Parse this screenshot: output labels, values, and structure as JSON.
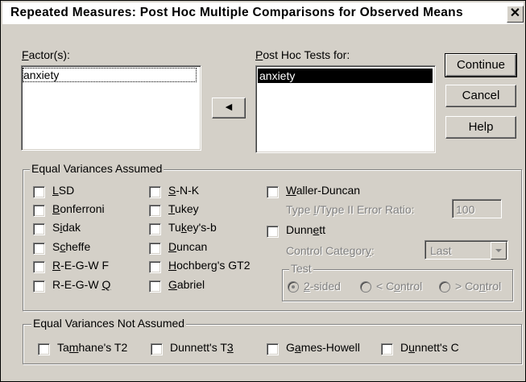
{
  "window": {
    "title": "Repeated Measures: Post Hoc Multiple Comparisons for Observed Means",
    "close": "✕"
  },
  "factors": {
    "label_u": "F",
    "label_rest": "actor(s):",
    "items": [
      "anxiety"
    ]
  },
  "posthoc": {
    "label_u": "P",
    "label_rest": "ost Hoc Tests for:",
    "items": [
      "anxiety"
    ]
  },
  "arrow": "◀",
  "buttons": {
    "continue": "Continue",
    "cancel": "Cancel",
    "help": "Help"
  },
  "equal_assumed": {
    "title": "Equal Variances Assumed",
    "col1": [
      {
        "pre": "",
        "u": "L",
        "post": "SD"
      },
      {
        "pre": "",
        "u": "B",
        "post": "onferroni"
      },
      {
        "pre": "S",
        "u": "i",
        "post": "dak"
      },
      {
        "pre": "S",
        "u": "c",
        "post": "heffe"
      },
      {
        "pre": "",
        "u": "R",
        "post": "-E-G-W F"
      },
      {
        "pre": "R-E-G-W ",
        "u": "Q",
        "post": ""
      }
    ],
    "col2": [
      {
        "pre": "",
        "u": "S",
        "post": "-N-K"
      },
      {
        "pre": "",
        "u": "T",
        "post": "ukey"
      },
      {
        "pre": "Tu",
        "u": "k",
        "post": "ey's-b"
      },
      {
        "pre": "",
        "u": "D",
        "post": "uncan"
      },
      {
        "pre": "",
        "u": "H",
        "post": "ochberg's GT2"
      },
      {
        "pre": "",
        "u": "G",
        "post": "abriel"
      }
    ],
    "waller": {
      "pre": "",
      "u": "W",
      "post": "aller-Duncan"
    },
    "ratio_label": {
      "pre": "Type ",
      "u": "I",
      "post": "/Type II Error Ratio:"
    },
    "ratio_value": "100",
    "dunnett": {
      "pre": "Dunn",
      "u": "e",
      "post": "tt"
    },
    "control_label": {
      "pre": "Control Categor",
      "u": "y",
      "post": ":"
    },
    "control_value": "Last",
    "test": {
      "title": "Test",
      "options": [
        {
          "pre": "",
          "u": "2",
          "post": "-sided"
        },
        {
          "pre": "< C",
          "u": "o",
          "post": "ntrol"
        },
        {
          "pre": "> Co",
          "u": "n",
          "post": "trol"
        }
      ]
    }
  },
  "equal_not_assumed": {
    "title": "Equal Variances Not Assumed",
    "items": [
      {
        "pre": "Ta",
        "u": "m",
        "post": "hane's T2"
      },
      {
        "pre": "Dunnett's T",
        "u": "3",
        "post": ""
      },
      {
        "pre": "G",
        "u": "a",
        "post": "mes-Howell"
      },
      {
        "pre": "D",
        "u": "u",
        "post": "nnett's C"
      }
    ]
  }
}
